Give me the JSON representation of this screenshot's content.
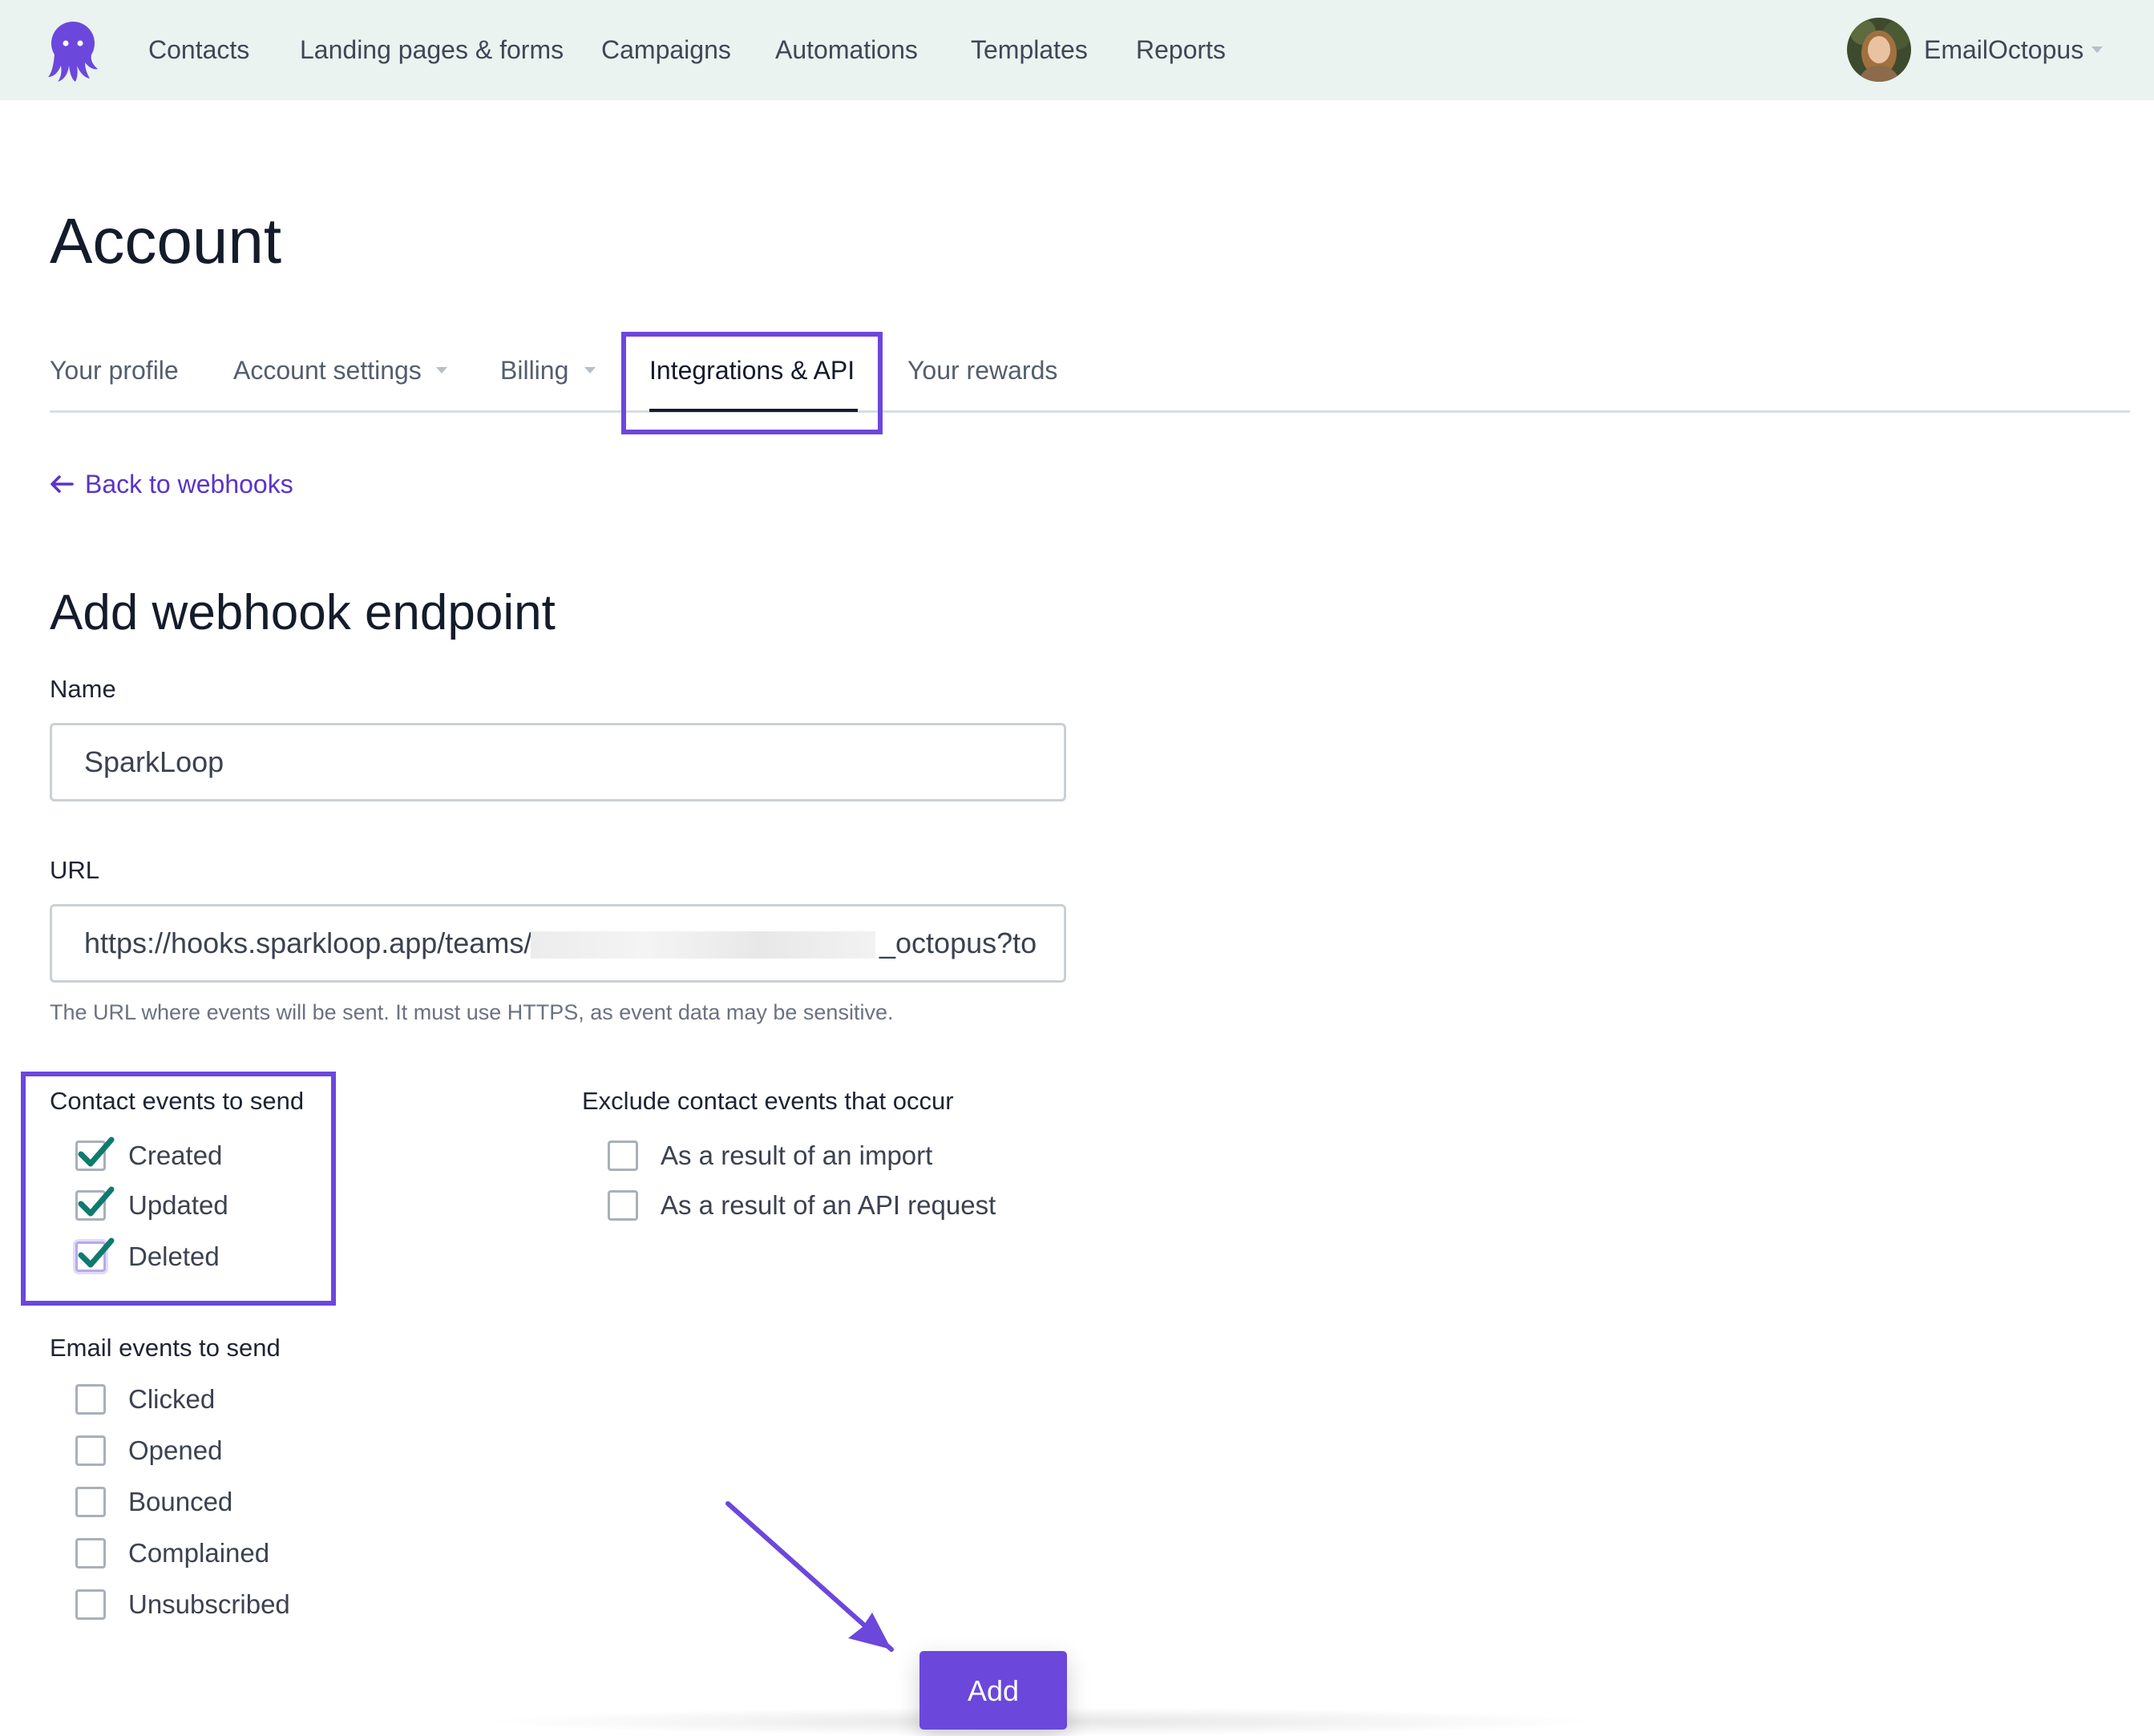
{
  "nav": {
    "items": [
      "Contacts",
      "Landing pages & forms",
      "Campaigns",
      "Automations",
      "Templates",
      "Reports"
    ],
    "account_name": "EmailOctopus"
  },
  "page": {
    "title": "Account"
  },
  "tabs": {
    "items": [
      {
        "label": "Your profile",
        "dropdown": false,
        "active": false
      },
      {
        "label": "Account settings",
        "dropdown": true,
        "active": false
      },
      {
        "label": "Billing",
        "dropdown": true,
        "active": false
      },
      {
        "label": "Integrations & API",
        "dropdown": false,
        "active": true
      },
      {
        "label": "Your rewards",
        "dropdown": false,
        "active": false
      }
    ]
  },
  "back_link": {
    "label": "Back to webhooks"
  },
  "form": {
    "title": "Add webhook endpoint",
    "name": {
      "label": "Name",
      "value": "SparkLoop"
    },
    "url": {
      "label": "URL",
      "value_start": "https://hooks.sparkloop.app/teams/",
      "value_end": "_octopus?to",
      "help": "The URL where events will be sent. It must use HTTPS, as event data may be sensitive."
    },
    "contact_events": {
      "label": "Contact events to send",
      "options": [
        {
          "label": "Created",
          "checked": true
        },
        {
          "label": "Updated",
          "checked": true
        },
        {
          "label": "Deleted",
          "checked": true
        }
      ]
    },
    "exclude_events": {
      "label": "Exclude contact events that occur",
      "options": [
        {
          "label": "As a result of an import",
          "checked": false
        },
        {
          "label": "As a result of an API request",
          "checked": false
        }
      ]
    },
    "email_events": {
      "label": "Email events to send",
      "options": [
        {
          "label": "Clicked",
          "checked": false
        },
        {
          "label": "Opened",
          "checked": false
        },
        {
          "label": "Bounced",
          "checked": false
        },
        {
          "label": "Complained",
          "checked": false
        },
        {
          "label": "Unsubscribed",
          "checked": false
        }
      ]
    },
    "submit_label": "Add"
  },
  "colors": {
    "brand": "#6b47dc",
    "nav_background": "#eaf3ef",
    "checkmark": "#0f7a6e",
    "link": "#5a33c9"
  }
}
